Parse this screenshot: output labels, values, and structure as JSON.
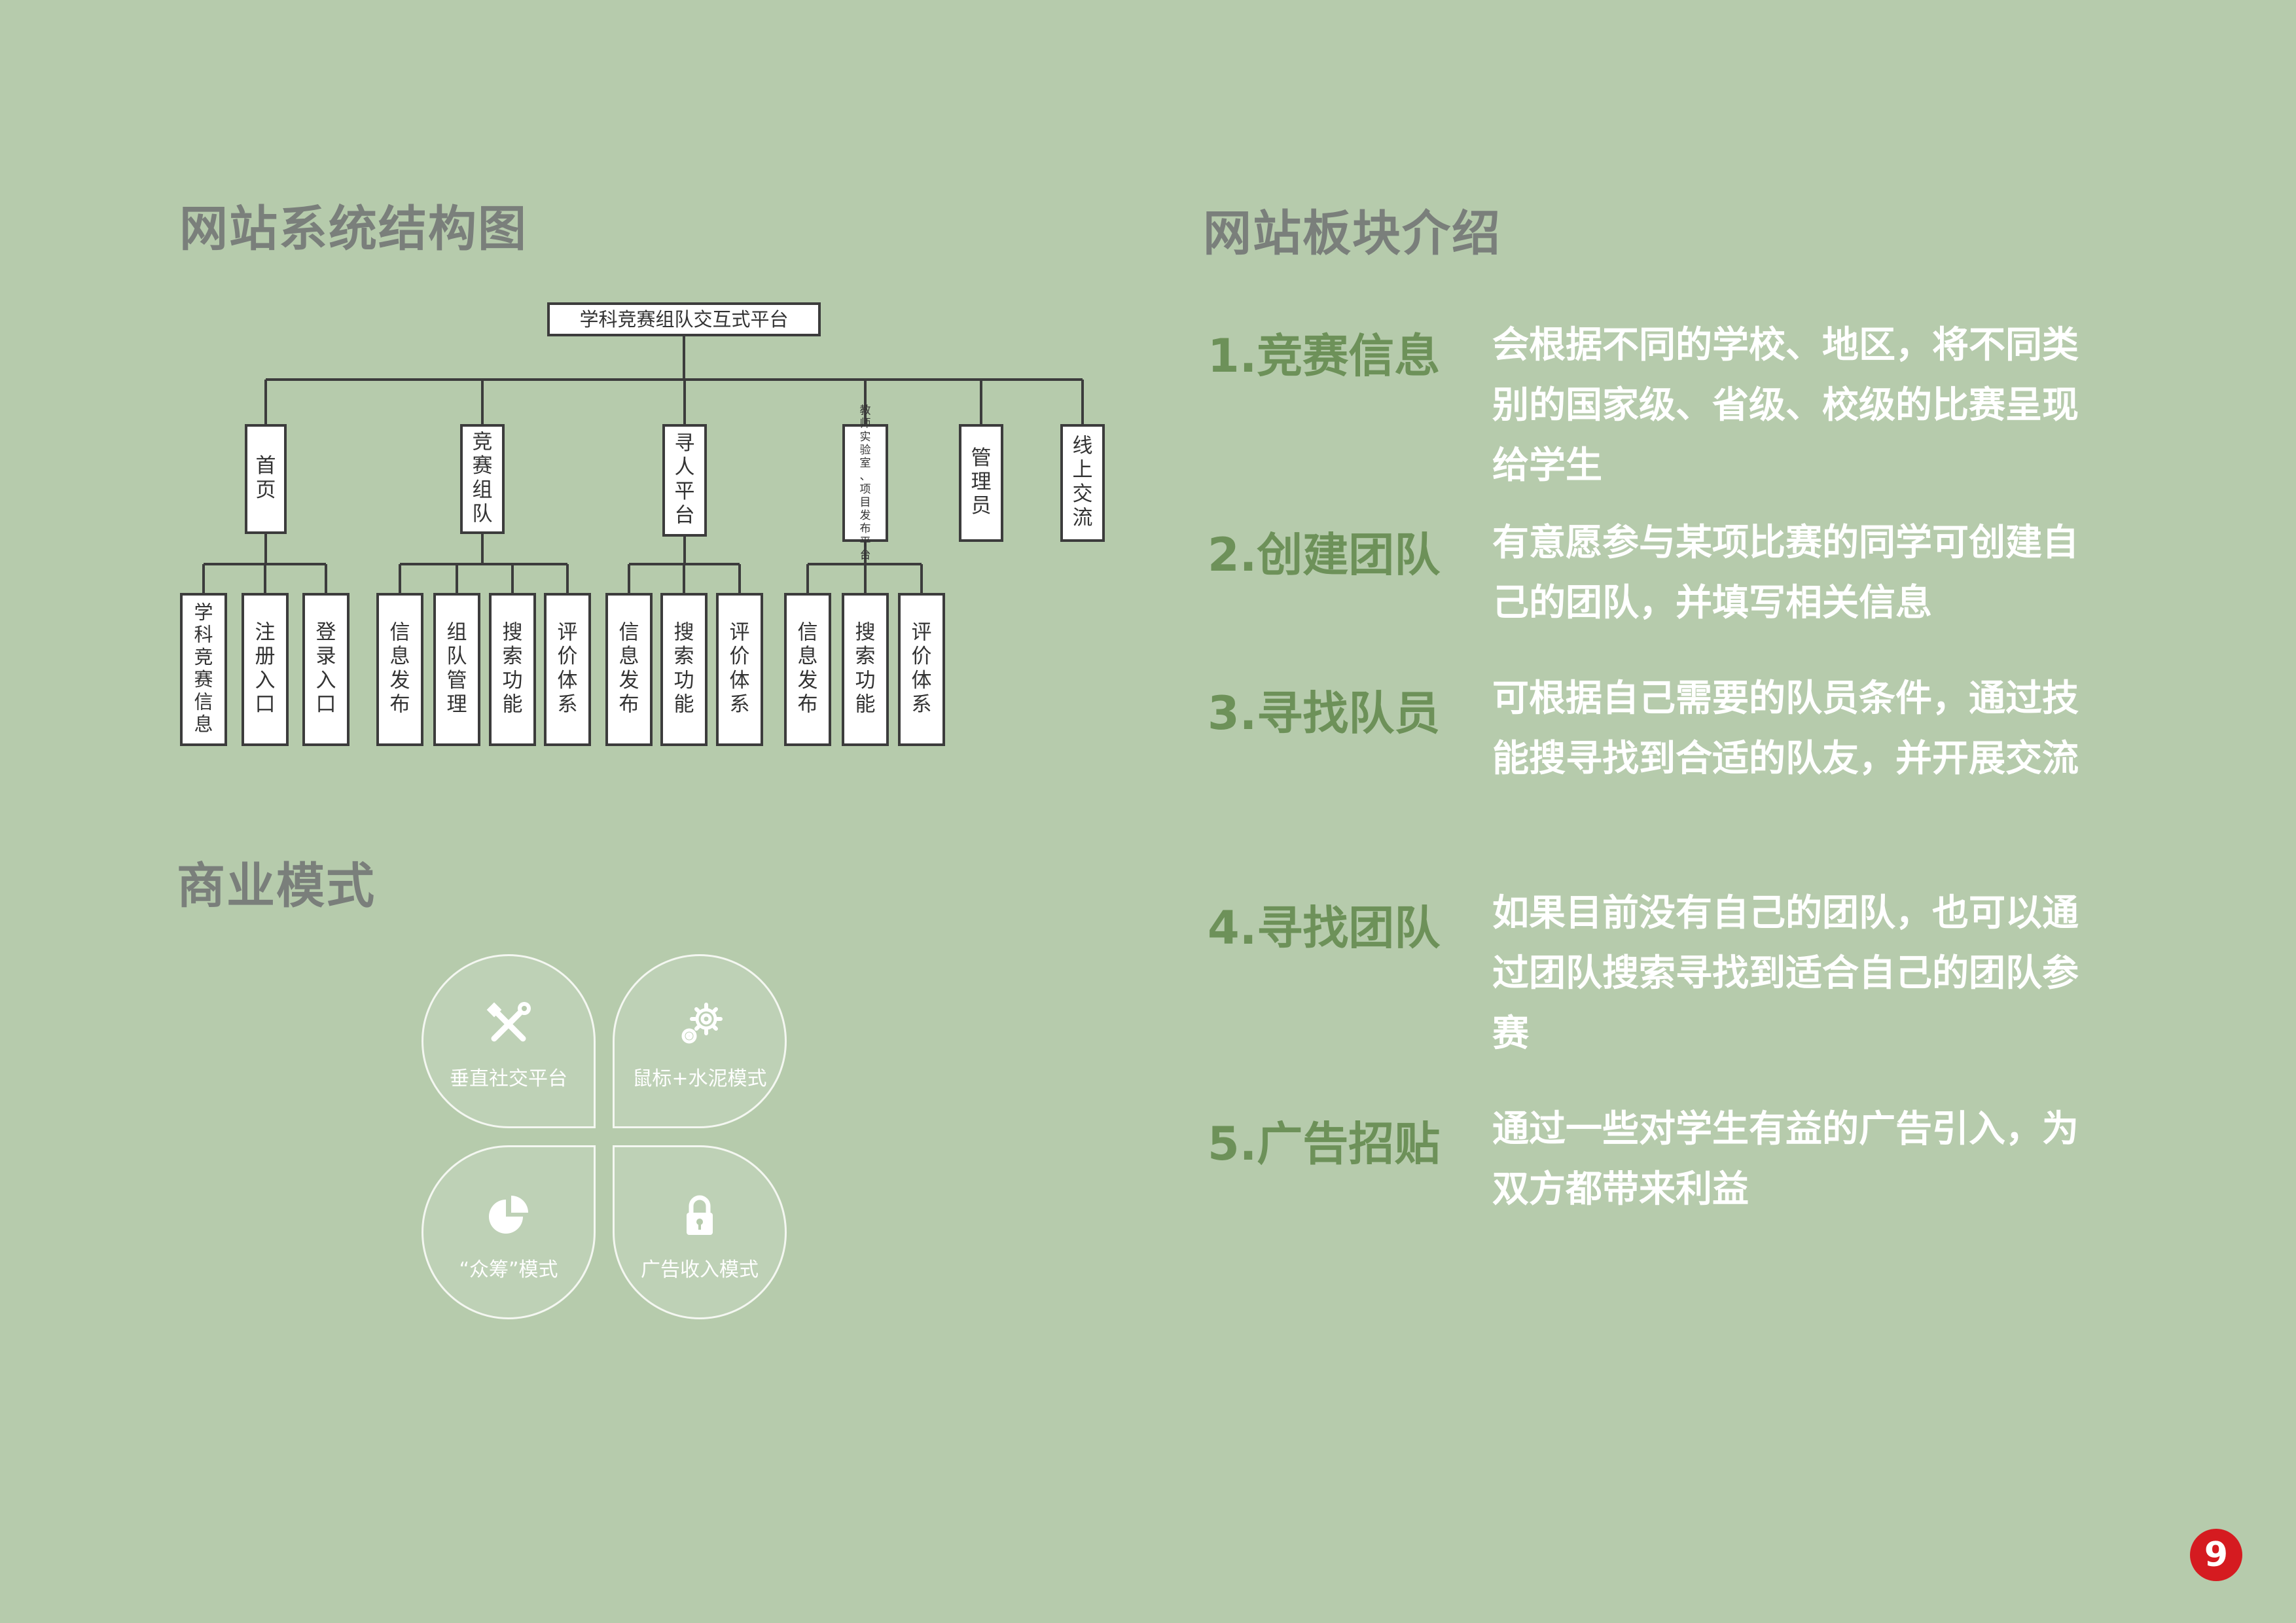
{
  "structure": {
    "heading": "网站系统结构图",
    "root": "学科竞赛组队交互式平台",
    "branches": [
      {
        "label": "首页",
        "children": [
          "学科竞赛信息",
          "注册入口",
          "登录入口"
        ]
      },
      {
        "label": "竞赛组队",
        "children": [
          "信息发布",
          "组队管理",
          "搜索功能",
          "评价体系"
        ]
      },
      {
        "label": "寻人平台",
        "children": [
          "信息发布",
          "搜索功能",
          "评价体系"
        ]
      },
      {
        "label": "教师实验室、项目发布平台",
        "children": [
          "信息发布",
          "搜索功能",
          "评价体系"
        ]
      },
      {
        "label": "管理员",
        "children": []
      },
      {
        "label": "线上交流",
        "children": []
      }
    ]
  },
  "business": {
    "heading": "商业模式",
    "items": [
      {
        "label": "垂直社交平台",
        "icon": "tools-icon"
      },
      {
        "label": "鼠标+水泥模式",
        "icon": "gears-icon"
      },
      {
        "label": "“众筹”模式",
        "icon": "pie-chart-icon"
      },
      {
        "label": "广告收入模式",
        "icon": "lock-icon"
      }
    ]
  },
  "sections": {
    "heading": "网站板块介绍",
    "items": [
      {
        "title": "1.竞赛信息",
        "desc": "会根据不同的学校、地区，将不同类别的国家级、省级、校级的比赛呈现给学生"
      },
      {
        "title": "2.创建团队",
        "desc": "有意愿参与某项比赛的同学可创建自己的团队，并填写相关信息"
      },
      {
        "title": "3.寻找队员",
        "desc": "可根据自己需要的队员条件，通过技能搜寻找到合适的队友，并开展交流"
      },
      {
        "title": "4.寻找团队",
        "desc": "如果目前没有自己的团队，也可以通过团队搜索寻找到适合自己的团队参赛"
      },
      {
        "title": "5.广告招贴",
        "desc": "通过一些对学生有益的广告引入，为双方都带来利益"
      }
    ]
  },
  "page_number": "9",
  "colors": {
    "background": "#b6cbac",
    "heading_gray": "#7a7f7b",
    "title_green": "#6d9159",
    "badge_red": "#d51b20"
  }
}
